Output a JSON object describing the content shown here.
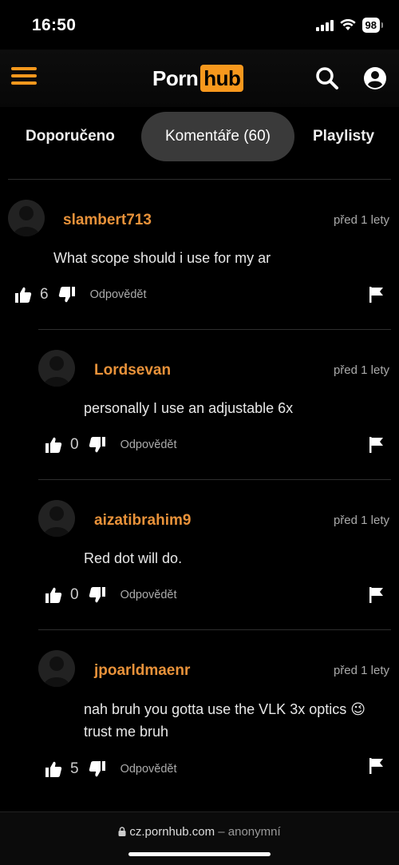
{
  "status": {
    "time": "16:50",
    "battery": "98"
  },
  "header": {
    "logo_part1": "Porn",
    "logo_part2": "hub"
  },
  "tabs": [
    {
      "label": "Doporučeno"
    },
    {
      "label": "Komentáře (60)"
    },
    {
      "label": "Playlisty"
    }
  ],
  "comments": [
    {
      "username": "slambert713",
      "time": "před 1 lety",
      "text": "What scope should i use for my ar",
      "likes": "6",
      "reply_label": "Odpovědět"
    },
    {
      "username": "Lordsevan",
      "time": "před 1 lety",
      "text": "personally I use an adjustable 6x",
      "likes": "0",
      "reply_label": "Odpovědět"
    },
    {
      "username": "aizatibrahim9",
      "time": "před 1 lety",
      "text": "Red dot will do.",
      "likes": "0",
      "reply_label": "Odpovědět"
    },
    {
      "username": "jpoarldmaenr",
      "time": "před 1 lety",
      "text": "nah bruh you gotta use the VLK 3x optics 😉 trust me bruh",
      "likes": "5",
      "reply_label": "Odpovědět"
    }
  ],
  "browser": {
    "domain": "cz.pornhub.com",
    "mode": "– anonymní"
  },
  "colors": {
    "accent": "#f7981d",
    "username": "#e8923a",
    "background": "#000000"
  }
}
